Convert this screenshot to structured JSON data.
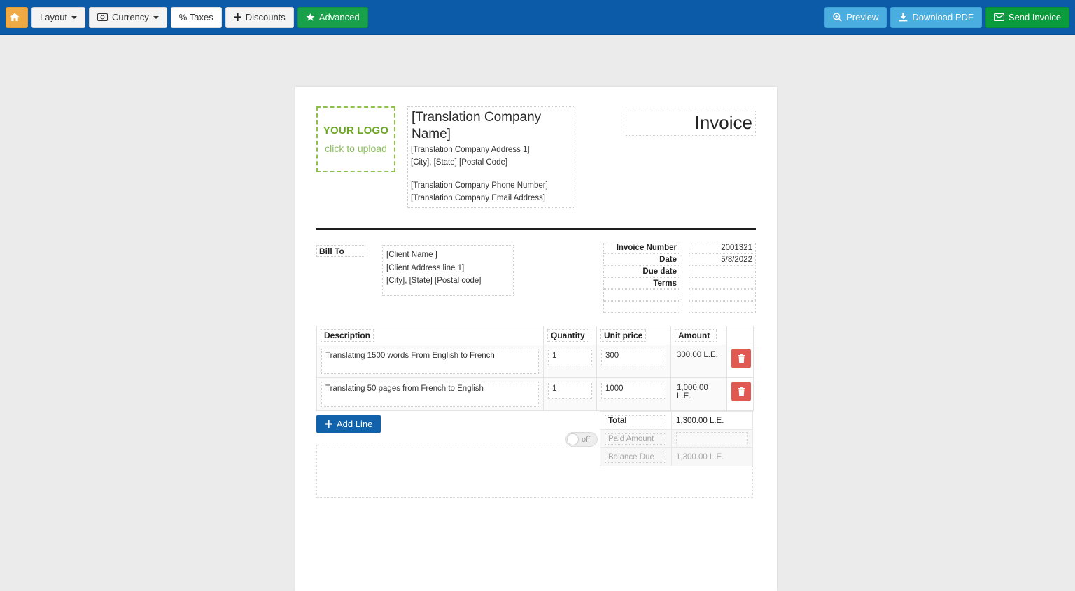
{
  "toolbar": {
    "left_buttons": [
      {
        "id": "home",
        "label": "",
        "icon": "home-icon",
        "caret": false
      },
      {
        "id": "layout",
        "label": "Layout",
        "icon": "",
        "caret": true
      },
      {
        "id": "currency",
        "label": "Currency",
        "icon": "money-icon",
        "caret": true
      },
      {
        "id": "taxes",
        "label": "% Taxes",
        "icon": "",
        "caret": false
      },
      {
        "id": "discounts",
        "label": "Discounts",
        "icon": "plus-icon",
        "caret": false
      },
      {
        "id": "advanced",
        "label": "Advanced",
        "icon": "star-icon",
        "caret": false
      }
    ],
    "right_buttons": [
      {
        "id": "preview",
        "label": "Preview",
        "icon": "search-plus-icon"
      },
      {
        "id": "download_pdf",
        "label": "Download PDF",
        "icon": "download-icon"
      },
      {
        "id": "send_invoice",
        "label": "Send Invoice",
        "icon": "envelope-icon"
      }
    ]
  },
  "invoice": {
    "logo": {
      "title": "YOUR LOGO",
      "subtitle": "click to upload"
    },
    "company": {
      "name": "[Translation Company Name]",
      "address1": "[Translation Company Address 1]",
      "city_state_zip": "[City], [State] [Postal Code]",
      "phone": "[Translation Company Phone Number]",
      "email": "[Translation Company Email Address]"
    },
    "title": "Invoice",
    "bill_to_label": "Bill To",
    "client": {
      "name": "[Client Name ]",
      "address1": "[Client Address line 1]",
      "city_state_zip": "[City], [State] [Postal code]"
    },
    "meta": [
      {
        "label": "Invoice Number",
        "value": "2001321"
      },
      {
        "label": "Date",
        "value": "5/8/2022"
      },
      {
        "label": "Due date",
        "value": ""
      },
      {
        "label": "Terms",
        "value": ""
      },
      {
        "label": "",
        "value": ""
      },
      {
        "label": "",
        "value": ""
      }
    ],
    "table": {
      "headers": [
        "Description",
        "Quantity",
        "Unit price",
        "Amount"
      ],
      "rows": [
        {
          "description": "Translating 1500 words From English to French",
          "quantity": "1",
          "unit_price": "300",
          "amount": "300.00 L.E."
        },
        {
          "description": "Translating 50 pages from French to English",
          "quantity": "1",
          "unit_price": "1000",
          "amount": "1,000.00 L.E."
        }
      ]
    },
    "add_line_label": "Add Line",
    "paid_toggle": {
      "state": "off",
      "label": "off"
    },
    "totals": [
      {
        "label": "Total",
        "value": "1,300.00 L.E.",
        "dim": false
      },
      {
        "label": "Paid Amount",
        "value": "",
        "dim": true
      },
      {
        "label": "Balance Due",
        "value": "1,300.00 L.E.",
        "dim": true
      }
    ],
    "notes": ""
  },
  "colors": {
    "toolbar_blue": "#0b5ba8",
    "home_orange": "#efa945",
    "advanced_green": "#18a04a",
    "send_green": "#0a9c3c",
    "preview_blue": "#4aaee0",
    "add_line_blue": "#1162ab",
    "delete_red": "#e05a51",
    "logo_green": "#8ec14a",
    "page_bg": "#ebebeb"
  }
}
